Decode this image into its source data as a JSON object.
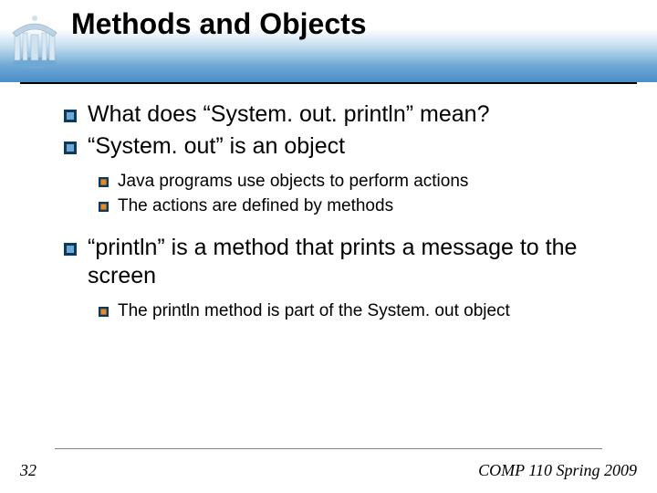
{
  "slide": {
    "title": "Methods and Objects",
    "number": "32",
    "footer": "COMP 110 Spring 2009"
  },
  "bullets": {
    "b1": "What does “System. out. println” mean?",
    "b2": "“System. out” is an object",
    "b2a": "Java programs use objects to perform actions",
    "b2b": "The actions are defined by methods",
    "b3": "“println” is a method that prints a message to the screen",
    "b3a": "The println method is part of the System. out object"
  }
}
